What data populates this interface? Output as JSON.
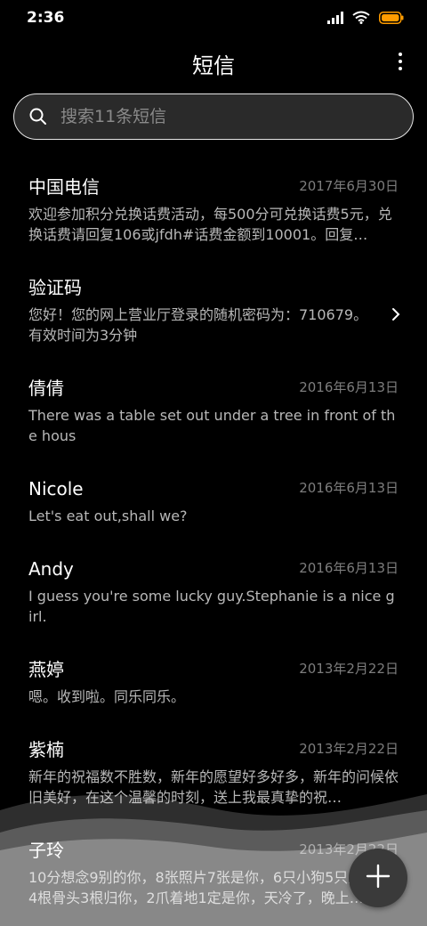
{
  "status": {
    "time": "2:36",
    "icons": [
      "signal-icon",
      "wifi-icon",
      "battery-icon"
    ],
    "battery_color": "#ff9c00"
  },
  "header": {
    "title": "短信",
    "menu_icon": "more-vertical-icon"
  },
  "search": {
    "placeholder": "搜索11条短信",
    "value": ""
  },
  "messages": [
    {
      "sender": "中国电信",
      "date": "2017年6月30日",
      "preview": "欢迎参加积分兑换话费活动，每500分可兑换话费5元，兑换话费请回复106或jfdh#话费金额到10001。回复…"
    },
    {
      "sender": "验证码",
      "date": "",
      "preview": "您好！您的网上营业厅登录的随机密码为：710679。有效时间为3分钟",
      "has_arrow": true
    },
    {
      "sender": "倩倩",
      "date": "2016年6月13日",
      "preview": "There was a table set out under a tree in front of the hous"
    },
    {
      "sender": "Nicole",
      "date": "2016年6月13日",
      "preview": "Let's eat out,shall we?"
    },
    {
      "sender": "Andy",
      "date": "2016年6月13日",
      "preview": "I guess you're some lucky guy.Stephanie is a nice girl."
    },
    {
      "sender": "燕婷",
      "date": "2013年2月22日",
      "preview": "嗯。收到啦。同乐同乐。"
    },
    {
      "sender": "紫楠",
      "date": "2013年2月22日",
      "preview": "新年的祝福数不胜数，新年的愿望好多好多，新年的问候依旧美好，在这个温馨的时刻，送上我最真挚的祝…"
    },
    {
      "sender": "子玲",
      "date": "2013年2月22日",
      "preview": "10分想念9别的你，8张照片7张是你，6只小狗5只是你，4根骨头3根归你，2爪着地1定是你，天冷了，晚上…"
    }
  ],
  "fab": {
    "icon": "plus-icon"
  },
  "colors": {
    "background": "#000000",
    "sender_text": "#ffffff",
    "preview_text": "#b8b8b8",
    "date_text": "#7d7d7d"
  }
}
